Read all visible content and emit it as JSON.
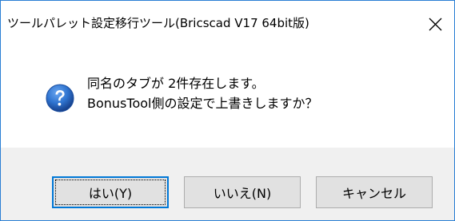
{
  "dialog": {
    "title": "ツールパレット設定移行ツール(Bricscad V17 64bit版)",
    "close_icon": "close-icon",
    "question_icon": "question-icon",
    "message_line1": "同名のタブが 2件存在します。",
    "message_line2": "BonusTool側の設定で上書きしますか？",
    "buttons": {
      "yes": "はい(Y)",
      "no": "いいえ(N)",
      "cancel": "キャンセル"
    }
  },
  "colors": {
    "title_border": "#2a7fd4",
    "footer_bg": "#f0f0f0",
    "button_bg": "#e1e1e1",
    "default_button_border": "#0078d7",
    "question_icon_blue": "#1c5fb8"
  }
}
